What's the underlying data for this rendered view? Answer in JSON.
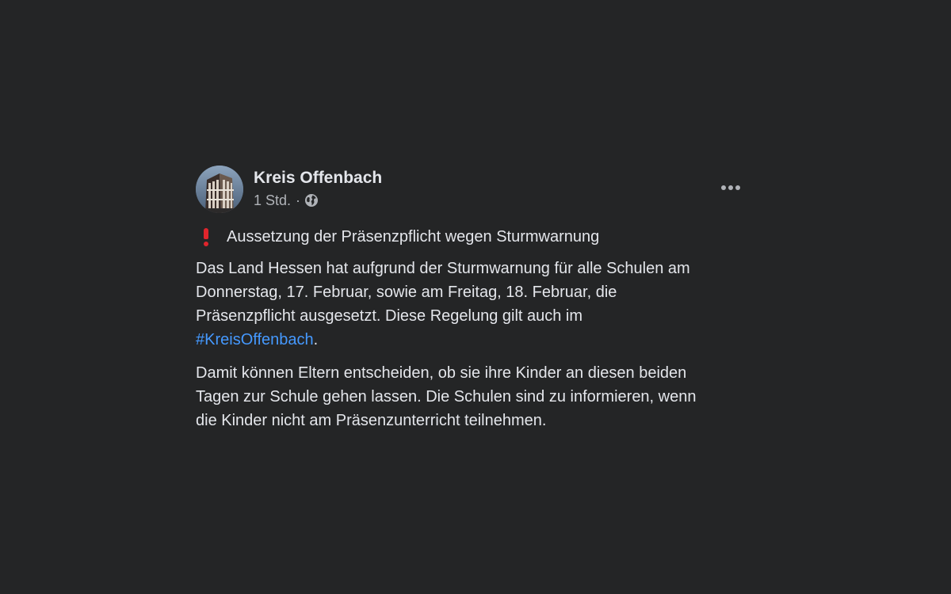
{
  "post": {
    "author": "Kreis Offenbach",
    "time": "1 Std.",
    "separator": "·",
    "privacy_icon": "globe-icon",
    "more_icon": "more-options-icon",
    "headline_icon": "red-exclamation-icon",
    "headline": "Aussetzung der Präsenzpflicht wegen Sturmwarnung",
    "paragraph1_lines": [
      "Das Land Hessen hat aufgrund der Sturmwarnung für alle Schulen am",
      "Donnerstag, 17. Februar, sowie am Freitag, 18. Februar, die",
      "Präsenzpflicht ausgesetzt. Diese Regelung gilt auch im"
    ],
    "hashtag": "#KreisOffenbach",
    "hashtag_suffix": ".",
    "paragraph2_lines": [
      "Damit können Eltern entscheiden, ob sie ihre Kinder an diesen beiden",
      "Tagen zur Schule gehen lassen. Die Schulen sind zu informieren, wenn",
      "die Kinder nicht am Präsenzunterricht teilnehmen."
    ]
  },
  "colors": {
    "background": "#242526",
    "text_primary": "#e4e6eb",
    "text_secondary": "#b0b3b8",
    "link": "#4599ff",
    "exclamation": "#e0252c"
  }
}
